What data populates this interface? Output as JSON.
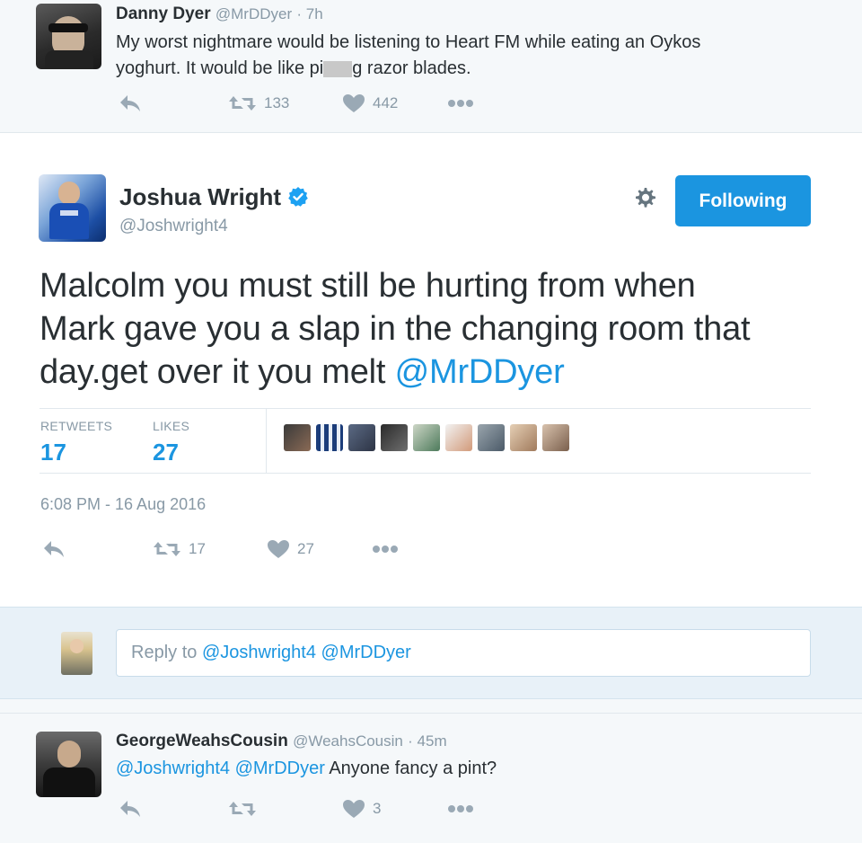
{
  "top_tweet": {
    "name": "Danny Dyer",
    "handle": "@MrDDyer",
    "time": "· 7h",
    "text_line1": "My worst nightmare would be listening to Heart FM while eating an Oykos",
    "text_line2_before": "yoghurt.  It would be like pi",
    "text_line2_after": "g razor blades.",
    "retweets": "133",
    "likes": "442"
  },
  "main_tweet": {
    "name": "Joshua Wright",
    "handle": "@Joshwright4",
    "follow_label": "Following",
    "text_line1": "Malcolm you must still be hurting from when",
    "text_line2": "Mark gave you a slap in the changing room that",
    "text_line3": "day.get over it you melt ",
    "mention": "@MrDDyer",
    "retweets_label": "RETWEETS",
    "retweets_count": "17",
    "likes_label": "LIKES",
    "likes_count": "27",
    "timestamp": "6:08 PM - 16 Aug 2016",
    "action_retweets": "17",
    "action_likes": "27"
  },
  "reply_box": {
    "placeholder_prefix": "Reply to ",
    "placeholder_mentions": "@Joshwright4 @MrDDyer"
  },
  "bottom_tweet": {
    "name": "GeorgeWeahsCousin",
    "handle": "@WeahsCousin",
    "time": "· 45m",
    "mention1": "@Joshwright4",
    "mention2": "@MrDDyer",
    "text": " Anyone fancy a pint?",
    "likes": "3"
  },
  "colors": {
    "accent": "#1b95e0",
    "muted": "#8899a6",
    "text": "#292f33",
    "background": "#f5f8fa"
  },
  "icons": [
    "reply-icon",
    "retweet-icon",
    "heart-icon",
    "more-icon",
    "gear-icon",
    "verified-icon"
  ]
}
